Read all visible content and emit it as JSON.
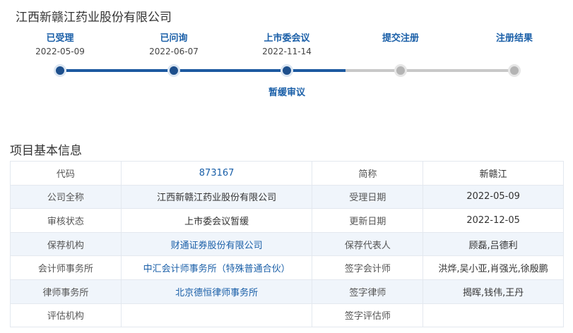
{
  "company_name": "江西新赣江药业股份有限公司",
  "progress": {
    "steps": [
      {
        "label": "已受理",
        "date": "2022-05-09",
        "status": "done"
      },
      {
        "label": "已问询",
        "date": "2022-06-07",
        "status": "done"
      },
      {
        "label": "上市委会议",
        "date": "2022-11-14",
        "status": "done",
        "sub_label": "暂缓审议"
      },
      {
        "label": "提交注册",
        "date": "",
        "status": "pending"
      },
      {
        "label": "注册结果",
        "date": "",
        "status": "pending"
      }
    ],
    "completed_fraction": 0.5
  },
  "section_title": "项目基本信息",
  "info_table": {
    "rows": [
      {
        "k1": "代码",
        "v1": "873167",
        "k2": "简称",
        "v2": "新赣江"
      },
      {
        "k1": "公司全称",
        "v1": "江西新赣江药业股份有限公司",
        "k2": "受理日期",
        "v2": "2022-05-09"
      },
      {
        "k1": "审核状态",
        "v1": "上市委会议暂缓",
        "k2": "更新日期",
        "v2": "2022-12-05"
      },
      {
        "k1": "保荐机构",
        "v1": "财通证券股份有限公司",
        "k2": "保荐代表人",
        "v2": "顾磊,吕德利"
      },
      {
        "k1": "会计师事务所",
        "v1": "中汇会计师事务所（特殊普通合伙）",
        "k2": "签字会计师",
        "v2": "洪烨,吴小亚,肖强光,徐殷鹏"
      },
      {
        "k1": "律师事务所",
        "v1": "北京德恒律师事务所",
        "k2": "签字律师",
        "v2": "揭晖,钱伟,王丹"
      },
      {
        "k1": "评估机构",
        "v1": "",
        "k2": "签字评估师",
        "v2": ""
      }
    ]
  },
  "colors": {
    "accent": "#1a5fa8",
    "track_done": "#1d5aa0",
    "track_pending": "#c8c8c8",
    "row_alt": "#f0f5fb"
  }
}
